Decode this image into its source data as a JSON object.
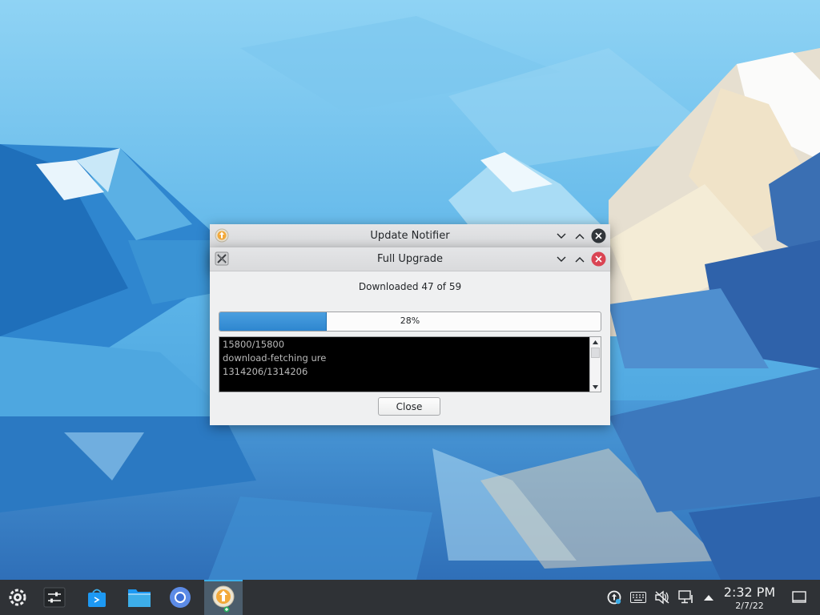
{
  "colors": {
    "accent": "#3daee9",
    "taskbar": "#2f3236",
    "progress_fill": "#2e86cf",
    "close_red": "#da4453"
  },
  "window_back": {
    "title": "Update Notifier",
    "icon": "update-notifier-icon",
    "buttons": [
      "minimize-icon",
      "maximize-icon",
      "close-icon"
    ]
  },
  "window_front": {
    "title": "Full Upgrade",
    "icon": "app-icon-x",
    "buttons": [
      "minimize-icon",
      "maximize-icon",
      "close-icon"
    ]
  },
  "dialog": {
    "status": "Downloaded 47 of 59",
    "close_label": "Close"
  },
  "progress": {
    "percent": 28,
    "label": "28%"
  },
  "terminal": {
    "lines": [
      "15800/15800",
      "download-fetching ure",
      "1314206/1314206"
    ]
  },
  "taskbar": {
    "launcher": "app-launcher-icon",
    "tasks": [
      "system-settings-icon",
      "discover-store-icon",
      "file-manager-icon",
      "chromium-browser-icon",
      "update-notifier-icon"
    ],
    "tray": [
      "update-tray-icon",
      "keyboard-icon",
      "volume-muted-icon",
      "network-icon",
      "show-hidden-chevron-icon"
    ],
    "time": "2:32 PM",
    "date": "2/7/22",
    "show_desktop": "show-desktop-icon"
  }
}
